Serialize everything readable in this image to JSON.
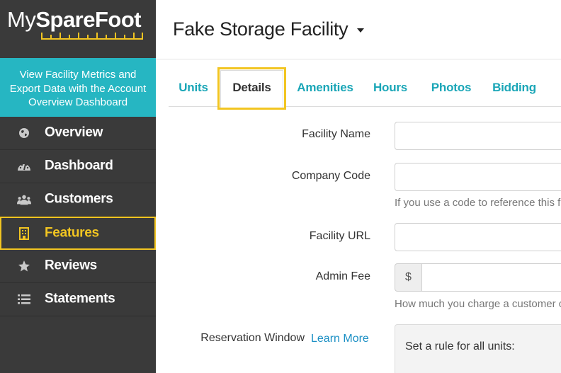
{
  "brand": {
    "part1": "My",
    "part2": "SpareFoot",
    "accent_color": "#f2c521"
  },
  "promo": {
    "line1": "View Facility Metrics and",
    "line2": "Export Data with the Account",
    "line3": "Overview Dashboard",
    "bg_color": "#26b6c2"
  },
  "sidebar": {
    "items": [
      {
        "label": "Overview",
        "icon": "globe-icon",
        "active": false
      },
      {
        "label": "Dashboard",
        "icon": "gauge-icon",
        "active": false
      },
      {
        "label": "Customers",
        "icon": "users-icon",
        "active": false
      },
      {
        "label": "Features",
        "icon": "building-icon",
        "active": true
      },
      {
        "label": "Reviews",
        "icon": "star-icon",
        "active": false
      },
      {
        "label": "Statements",
        "icon": "list-icon",
        "active": false
      }
    ]
  },
  "header": {
    "facility_name": "Fake Storage Facility"
  },
  "tabs": [
    {
      "label": "Units",
      "active": false
    },
    {
      "label": "Details",
      "active": true
    },
    {
      "label": "Amenities",
      "active": false
    },
    {
      "label": "Hours",
      "active": false
    },
    {
      "label": "Photos",
      "active": false
    },
    {
      "label": "Bidding",
      "active": false
    }
  ],
  "form": {
    "facility_name_label": "Facility Name",
    "facility_name_value": "",
    "company_code_label": "Company Code",
    "company_code_value": "",
    "company_code_help": "If you use a code to reference this f",
    "facility_url_label": "Facility URL",
    "facility_url_value": "",
    "admin_fee_label": "Admin Fee",
    "admin_fee_prefix": "$",
    "admin_fee_value": "",
    "admin_fee_help": "How much you charge a customer c",
    "reservation_window_label": "Reservation Window",
    "learn_more": "Learn More",
    "rule_panel_text": "Set a rule for all units:"
  }
}
